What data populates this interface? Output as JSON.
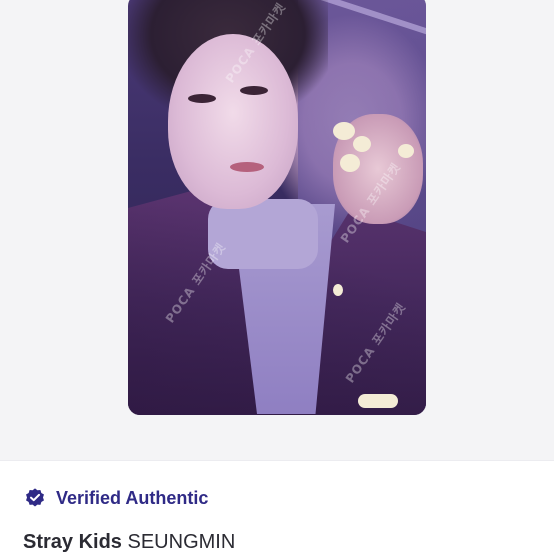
{
  "photocard": {
    "watermark_text": "POCA 포카마켓"
  },
  "badge": {
    "icon": "verified-check-icon",
    "label": "Verified Authentic",
    "color": "#2f2a86"
  },
  "item": {
    "artist": "Stray Kids",
    "member": "SEUNGMIN"
  }
}
